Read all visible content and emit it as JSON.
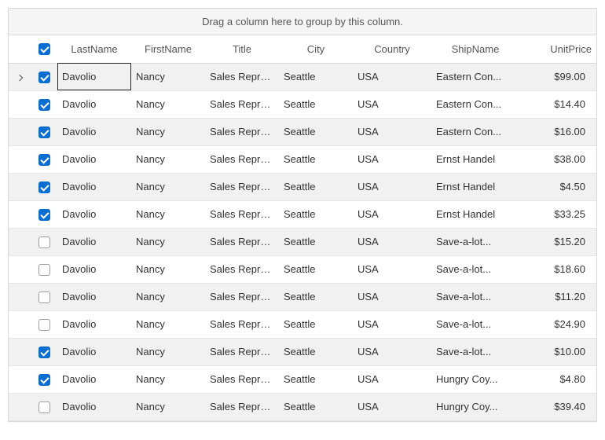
{
  "groupPanel": {
    "text": "Drag a column here to group by this column."
  },
  "columns": {
    "lastName": "LastName",
    "firstName": "FirstName",
    "title": "Title",
    "city": "City",
    "country": "Country",
    "shipName": "ShipName",
    "unitPrice": "UnitPrice"
  },
  "headerChecked": true,
  "rows": [
    {
      "expand": true,
      "checked": true,
      "focused": true,
      "lastName": "Davolio",
      "firstName": "Nancy",
      "title": "Sales  Repres...",
      "city": "Seattle",
      "country": "USA",
      "shipName": "Eastern Con...",
      "unitPrice": "$99.00"
    },
    {
      "expand": false,
      "checked": true,
      "focused": false,
      "lastName": "Davolio",
      "firstName": "Nancy",
      "title": "Sales  Repres...",
      "city": "Seattle",
      "country": "USA",
      "shipName": "Eastern Con...",
      "unitPrice": "$14.40"
    },
    {
      "expand": false,
      "checked": true,
      "focused": false,
      "lastName": "Davolio",
      "firstName": "Nancy",
      "title": "Sales  Repres...",
      "city": "Seattle",
      "country": "USA",
      "shipName": "Eastern Con...",
      "unitPrice": "$16.00"
    },
    {
      "expand": false,
      "checked": true,
      "focused": false,
      "lastName": "Davolio",
      "firstName": "Nancy",
      "title": "Sales  Repres...",
      "city": "Seattle",
      "country": "USA",
      "shipName": "Ernst Handel",
      "unitPrice": "$38.00"
    },
    {
      "expand": false,
      "checked": true,
      "focused": false,
      "lastName": "Davolio",
      "firstName": "Nancy",
      "title": "Sales  Repres...",
      "city": "Seattle",
      "country": "USA",
      "shipName": "Ernst Handel",
      "unitPrice": "$4.50"
    },
    {
      "expand": false,
      "checked": true,
      "focused": false,
      "lastName": "Davolio",
      "firstName": "Nancy",
      "title": "Sales  Repres...",
      "city": "Seattle",
      "country": "USA",
      "shipName": "Ernst Handel",
      "unitPrice": "$33.25"
    },
    {
      "expand": false,
      "checked": false,
      "focused": false,
      "lastName": "Davolio",
      "firstName": "Nancy",
      "title": "Sales  Repres...",
      "city": "Seattle",
      "country": "USA",
      "shipName": "Save-a-lot...",
      "unitPrice": "$15.20"
    },
    {
      "expand": false,
      "checked": false,
      "focused": false,
      "lastName": "Davolio",
      "firstName": "Nancy",
      "title": "Sales  Repres...",
      "city": "Seattle",
      "country": "USA",
      "shipName": "Save-a-lot...",
      "unitPrice": "$18.60"
    },
    {
      "expand": false,
      "checked": false,
      "focused": false,
      "lastName": "Davolio",
      "firstName": "Nancy",
      "title": "Sales  Repres...",
      "city": "Seattle",
      "country": "USA",
      "shipName": "Save-a-lot...",
      "unitPrice": "$11.20"
    },
    {
      "expand": false,
      "checked": false,
      "focused": false,
      "lastName": "Davolio",
      "firstName": "Nancy",
      "title": "Sales  Repres...",
      "city": "Seattle",
      "country": "USA",
      "shipName": "Save-a-lot...",
      "unitPrice": "$24.90"
    },
    {
      "expand": false,
      "checked": true,
      "focused": false,
      "lastName": "Davolio",
      "firstName": "Nancy",
      "title": "Sales  Repres...",
      "city": "Seattle",
      "country": "USA",
      "shipName": "Save-a-lot...",
      "unitPrice": "$10.00"
    },
    {
      "expand": false,
      "checked": true,
      "focused": false,
      "lastName": "Davolio",
      "firstName": "Nancy",
      "title": "Sales  Repres...",
      "city": "Seattle",
      "country": "USA",
      "shipName": "Hungry Coy...",
      "unitPrice": "$4.80"
    },
    {
      "expand": false,
      "checked": false,
      "focused": false,
      "lastName": "Davolio",
      "firstName": "Nancy",
      "title": "Sales  Repres...",
      "city": "Seattle",
      "country": "USA",
      "shipName": "Hungry Coy...",
      "unitPrice": "$39.40"
    }
  ]
}
